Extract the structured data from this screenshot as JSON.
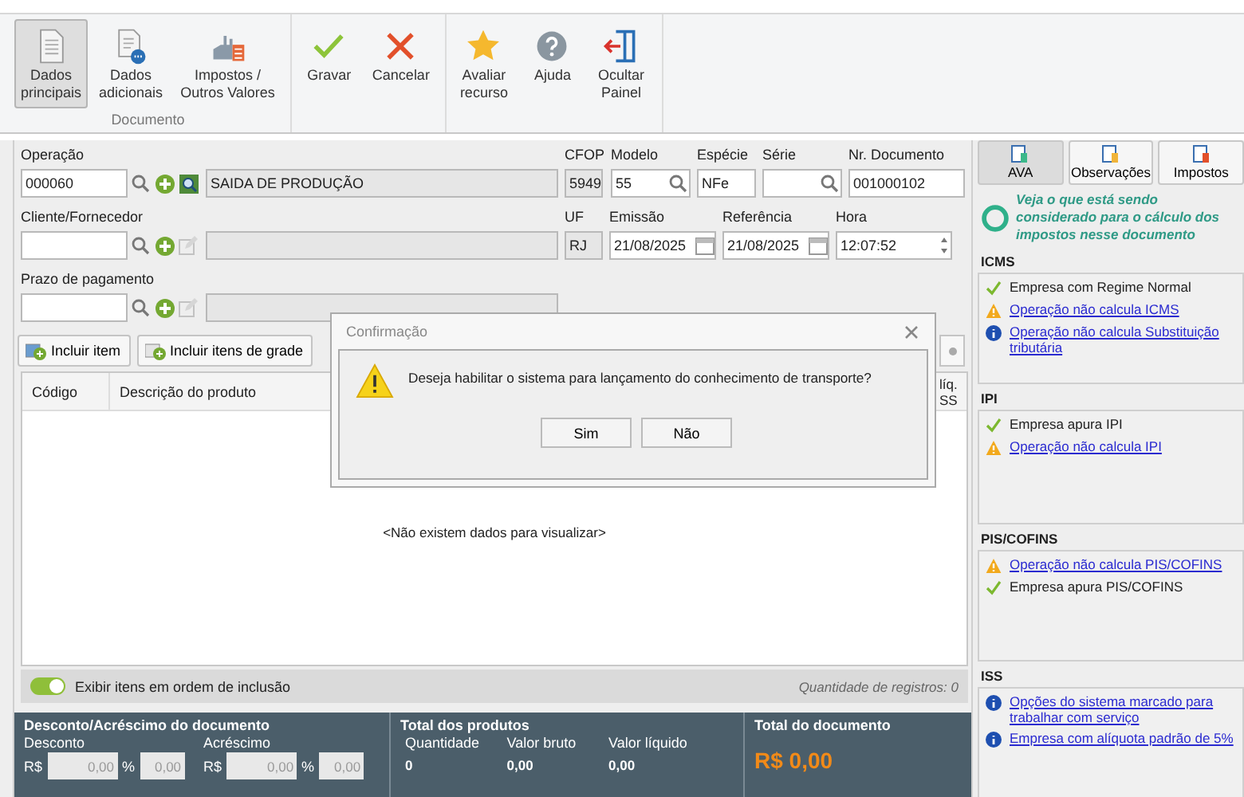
{
  "ribbon": {
    "groups": [
      {
        "label": "Documento",
        "buttons": [
          {
            "kind": "document",
            "label": [
              "Dados",
              "principais"
            ],
            "selected": true
          },
          {
            "kind": "document-more",
            "label": [
              "Dados",
              "adicionais"
            ],
            "selected": false
          },
          {
            "kind": "factory",
            "label": [
              "Impostos /",
              "Outros Valores"
            ],
            "selected": false
          }
        ]
      },
      {
        "buttons": [
          {
            "kind": "check",
            "label": [
              "Gravar"
            ],
            "selected": false
          },
          {
            "kind": "cross",
            "label": [
              "Cancelar"
            ],
            "selected": false
          }
        ]
      },
      {
        "buttons": [
          {
            "kind": "star",
            "label": [
              "Avaliar",
              "recurso"
            ],
            "selected": false
          },
          {
            "kind": "help",
            "label": [
              "Ajuda"
            ],
            "selected": false
          },
          {
            "kind": "exit",
            "label": [
              "Ocultar",
              "Painel"
            ],
            "selected": false
          }
        ]
      }
    ]
  },
  "form": {
    "rows": [
      {
        "lookup": {
          "label": "Operação",
          "value": "000060",
          "has_lookup": true,
          "description": "SAIDA DE PRODUÇÃO"
        },
        "fields": [
          {
            "kind": "readonly",
            "label": "CFOP",
            "value": "5949"
          },
          {
            "kind": "search",
            "label": "Modelo",
            "value": "55"
          },
          {
            "kind": "text",
            "label": "Espécie",
            "value": "NFe"
          },
          {
            "kind": "search",
            "label": "Série"
          },
          {
            "kind": "text",
            "label": "Nr. Documento",
            "value": "001000102"
          }
        ]
      },
      {
        "lookup": {
          "label": "Cliente/Fornecedor",
          "has_lookup": false
        },
        "fields": [
          {
            "kind": "readonly",
            "label": "UF",
            "value": "RJ"
          },
          {
            "kind": "date",
            "label": "Emissão",
            "value": "21/08/2025"
          },
          {
            "kind": "date",
            "label": "Referência",
            "value": "21/08/2025"
          },
          {
            "kind": "time",
            "label": "Hora",
            "value": "12:07:52"
          }
        ]
      },
      {
        "lookup": {
          "label": "Prazo de pagamento",
          "has_lookup": false
        }
      }
    ]
  },
  "actions": [
    "Incluir item",
    "Incluir itens de grade"
  ],
  "table": {
    "columns": [
      "Código",
      "Descrição do produto"
    ],
    "column_3": "líq. SS",
    "empty": "<Não existem dados para visualizar>"
  },
  "table_footer": {
    "toggle": {
      "label": "Exibir itens em ordem de inclusão",
      "on": true
    },
    "count": "Quantidade de registros: 0"
  },
  "totals": {
    "discount": {
      "title": "Desconto/Acréscimo do documento",
      "groups": [
        {
          "label": "Desconto",
          "fields": [
            {
              "prefix": "R$",
              "value": "0,00",
              "disabled": true
            },
            {
              "prefix": "%",
              "value": "0,00",
              "disabled": true
            }
          ]
        },
        {
          "label": "Acréscimo",
          "fields": [
            {
              "prefix": "R$",
              "value": "0,00",
              "disabled": true
            },
            {
              "prefix": "%",
              "value": "0,00",
              "disabled": true
            }
          ]
        }
      ]
    },
    "products": {
      "title": "Total dos produtos",
      "columns": [
        {
          "label": "Quantidade",
          "value": "0"
        },
        {
          "label": "Valor bruto",
          "value": "0,00"
        },
        {
          "label": "Valor líquido",
          "value": "0,00"
        }
      ]
    },
    "document": {
      "title": "Total do documento",
      "value": "R$ 0,00"
    }
  },
  "side_panel": {
    "tabs": [
      {
        "label": "AVA",
        "selected": true
      },
      {
        "label": "Observações",
        "selected": false
      },
      {
        "label": "Impostos",
        "selected": false
      }
    ],
    "intro": "Veja o que está sendo considerado para o cálculo dos impostos nesse documento",
    "sections": [
      {
        "title": "ICMS",
        "items": [
          {
            "kind": "check",
            "text": "Empresa com Regime Normal",
            "link": false
          },
          {
            "kind": "warning",
            "text": "Operação não calcula ICMS",
            "link": true
          },
          {
            "kind": "info",
            "text": "Operação não calcula Substituição tributária",
            "link": true
          }
        ]
      },
      {
        "title": "IPI",
        "items": [
          {
            "kind": "check",
            "text": "Empresa apura IPI",
            "link": false
          },
          {
            "kind": "warning",
            "text": "Operação não calcula IPI",
            "link": true
          }
        ]
      },
      {
        "title": "PIS/COFINS",
        "items": [
          {
            "kind": "warning",
            "text": "Operação não calcula PIS/COFINS",
            "link": true
          },
          {
            "kind": "check",
            "text": "Empresa apura PIS/COFINS",
            "link": false
          }
        ]
      },
      {
        "title": "ISS",
        "items": [
          {
            "kind": "info",
            "text": "Opções do sistema marcado para trabalhar com serviço",
            "link": true
          },
          {
            "kind": "info",
            "text": "Empresa com alíquota padrão de 5%",
            "link": true
          }
        ]
      }
    ]
  },
  "dialog": {
    "title": "Confirmação",
    "message": "Deseja habilitar o sistema para lançamento do conhecimento de transporte?",
    "buttons": [
      "Sim",
      "Não"
    ]
  }
}
